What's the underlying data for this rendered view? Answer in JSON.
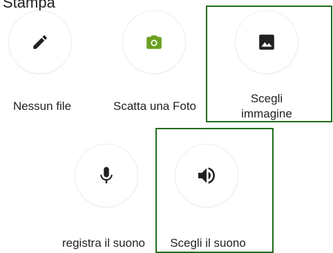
{
  "header": {
    "partial_text": "Stampa"
  },
  "options": [
    {
      "label": "Nessun file",
      "icon": "pencil-icon"
    },
    {
      "label": "Scatta una Foto",
      "icon": "camera-icon",
      "icon_color": "#6aa121"
    },
    {
      "label_line1": "Scegli",
      "label_line2": "immagine",
      "icon": "image-icon"
    },
    {
      "label": "registra il suono",
      "icon": "microphone-icon"
    },
    {
      "label": "Scegli il suono",
      "icon": "volume-icon"
    }
  ],
  "colors": {
    "highlight": "#1f6b1a",
    "icon": "#212121",
    "camera": "#6aa121"
  }
}
